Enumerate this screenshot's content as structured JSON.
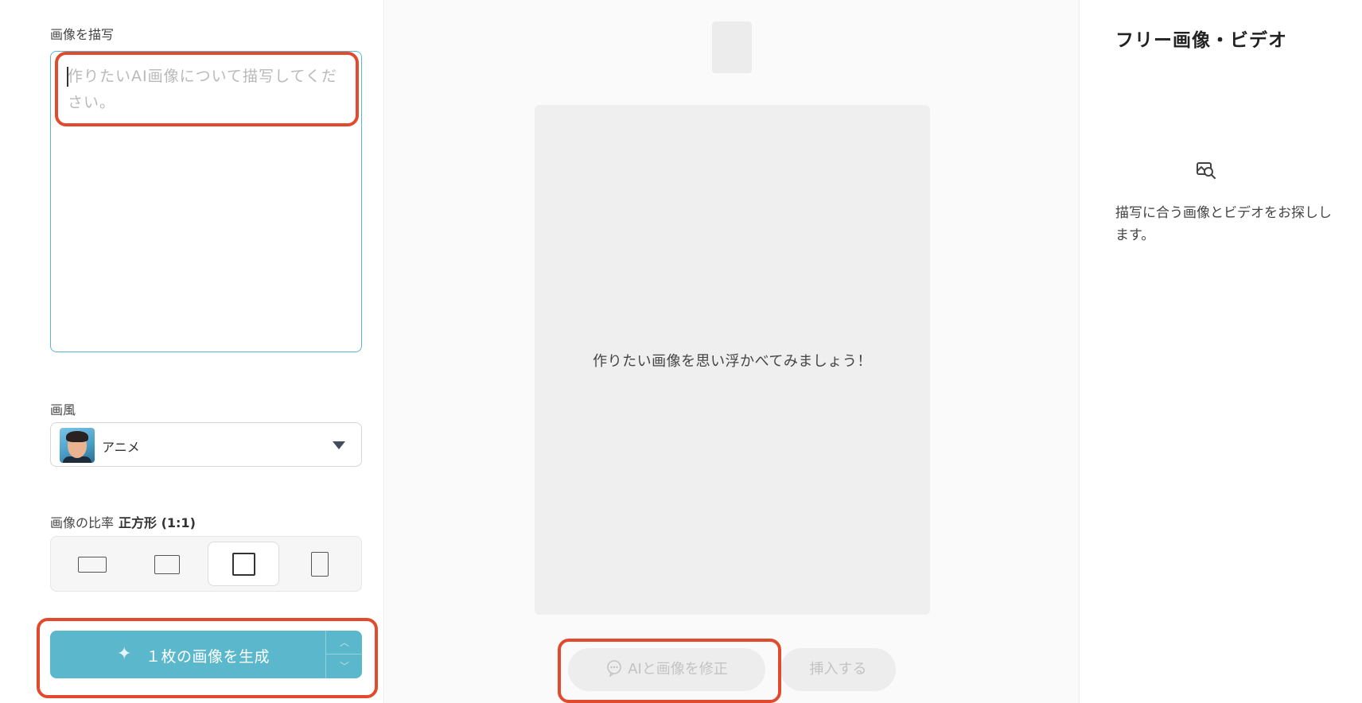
{
  "left": {
    "describe_label": "画像を描写",
    "prompt_placeholder": "作りたいAI画像について描写してください。",
    "style_label": "画風",
    "style_value": "アニメ",
    "ratio_label": "画像の比率",
    "ratio_value": "正方形 (1:1)",
    "ratio_options": [
      "landscape-wide",
      "landscape",
      "square",
      "portrait"
    ],
    "selected_ratio": "square",
    "generate_label": "１枚の画像を生成"
  },
  "center": {
    "canvas_hint": "作りたい画像を思い浮かべてみましょう！",
    "ai_edit_label": "AIと画像を修正",
    "insert_label": "挿入する"
  },
  "right": {
    "title": "フリー画像・ビデオ",
    "description": "描写に合う画像とビデオをお探しします。"
  },
  "colors": {
    "accent": "#5bb7cc",
    "highlight": "#e24a2e",
    "disabled_bg": "#ededed"
  }
}
